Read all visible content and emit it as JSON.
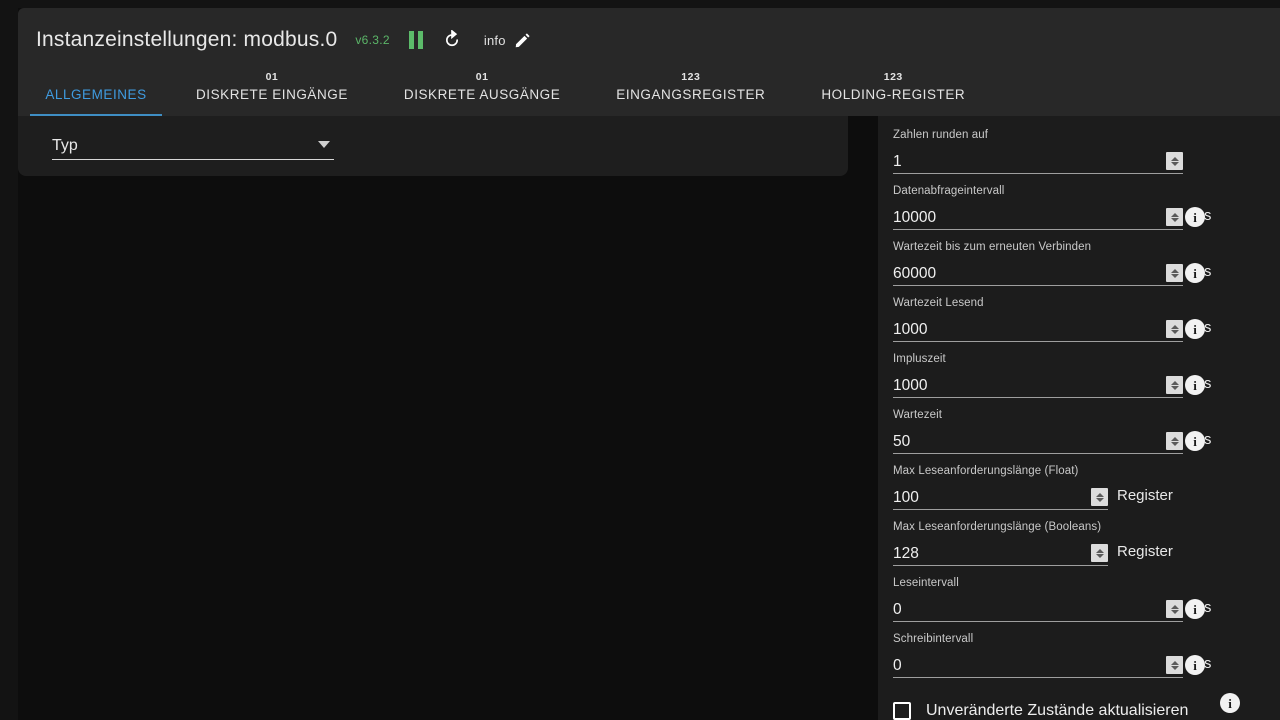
{
  "header": {
    "title": "Instanzeinstellungen: modbus.0",
    "version": "v6.3.2",
    "pause_icon": "pause-icon",
    "refresh_icon": "refresh-icon",
    "info_label": "info",
    "edit_icon": "pencil-icon"
  },
  "tabs": [
    {
      "label": "ALLGEMEINES",
      "icon": "",
      "active": true
    },
    {
      "label": "DISKRETE EINGÄNGE",
      "icon": "01",
      "active": false
    },
    {
      "label": "DISKRETE AUSGÄNGE",
      "icon": "01",
      "active": false
    },
    {
      "label": "EINGANGSREGISTER",
      "icon": "123",
      "active": false
    },
    {
      "label": "HOLDING-REGISTER",
      "icon": "123",
      "active": false
    }
  ],
  "left_panel": {
    "select": {
      "label": "Typ",
      "value": "",
      "caret_icon": "chevron-down-icon"
    }
  },
  "right_panel": {
    "fields": [
      {
        "label": "Zahlen runden auf",
        "value": "1",
        "unit": "",
        "has_info": false
      },
      {
        "label": "Datenabfrageintervall",
        "value": "10000",
        "unit": "ms",
        "has_info": true
      },
      {
        "label": "Wartezeit bis zum erneuten Verbinden",
        "value": "60000",
        "unit": "ms",
        "has_info": true
      },
      {
        "label": "Wartezeit Lesend",
        "value": "1000",
        "unit": "ms",
        "has_info": true
      },
      {
        "label": "Impluszeit",
        "value": "1000",
        "unit": "ms",
        "has_info": true
      },
      {
        "label": "Wartezeit",
        "value": "50",
        "unit": "ms",
        "has_info": true
      },
      {
        "label": "Max Leseanforderungslänge (Float)",
        "value": "100",
        "unit": "Register",
        "has_info": false
      },
      {
        "label": "Max Leseanforderungslänge (Booleans)",
        "value": "128",
        "unit": "Register",
        "has_info": false
      },
      {
        "label": "Leseintervall",
        "value": "0",
        "unit": "ms",
        "has_info": true
      },
      {
        "label": "Schreibintervall",
        "value": "0",
        "unit": "ms",
        "has_info": true
      }
    ],
    "checkbox": {
      "label": "Unveränderte Zustände aktualisieren",
      "checked": false,
      "has_info": true
    },
    "info_glyph": "i"
  },
  "colors": {
    "accent_blue": "#3f9be0",
    "accent_green": "#5cbb6a",
    "header_bg": "#282828",
    "card_bg": "#1e1e1e",
    "panel_bg": "#1c1c1c",
    "page_bg": "#0d0d0d"
  }
}
